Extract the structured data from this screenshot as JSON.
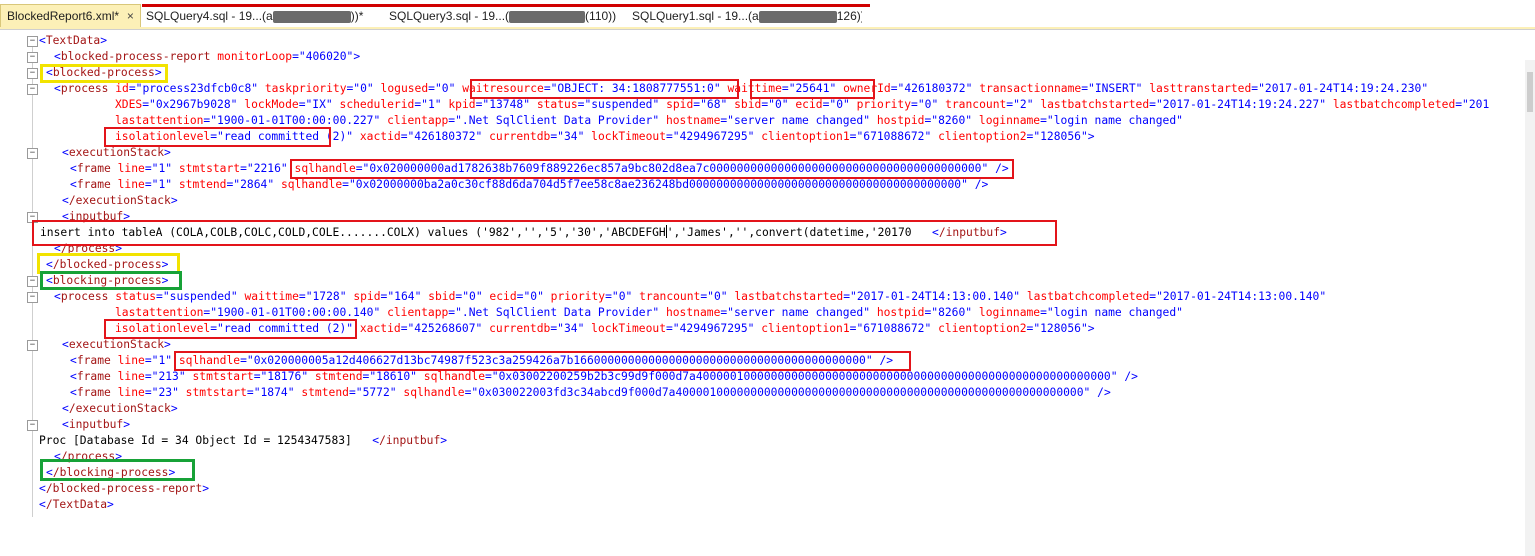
{
  "tabs": [
    {
      "label": "BlockedReport6.xml*",
      "active": true
    },
    {
      "label_a": "SQLQuery4.sql - 19...(a",
      "label_b": "))*"
    },
    {
      "label_a": "SQLQuery3.sql - 19...(",
      "label_b": "(110))"
    },
    {
      "label_a": "SQLQuery1.sql - 19...(a",
      "label_b": "126))"
    }
  ],
  "close_glyph": "×",
  "colors": {
    "highlight_red": "#e3141a",
    "highlight_yellow": "#f2e300",
    "highlight_green": "#17a237",
    "tag": "#a31515",
    "attr": "#ff0000",
    "bracket": "#0000ff"
  },
  "xml": {
    "l1": {
      "open": "<",
      "name": "TextData",
      "close": ">"
    },
    "l2": {
      "open": "<",
      "name": "blocked-process-report",
      "a1": " monitorLoop",
      "eq1": "=\"",
      "v1": "406020",
      "q1": "\"",
      "close": ">"
    },
    "l3": {
      "open": "<",
      "name": "blocked-process",
      "close": ">"
    },
    "l4": {
      "open": "<",
      "name": "process",
      "a1": " id",
      "v1": "process23dfcb0c8",
      "a2": " taskpriority",
      "v2": "0",
      "a3": " logused",
      "v3": "0",
      "a4": " waitresource",
      "v4": "OBJECT: 34:1808777551:0",
      "a5": " waittime",
      "v5": "25641",
      "a6": " ownerId",
      "v6": "426180372",
      "a7": " transactionname",
      "v7": "INSERT",
      "a8": " lasttranstarted",
      "v8": "2017-01-24T14:19:24.230"
    },
    "l5": {
      "a1": "XDES",
      "v1": "0x2967b9028",
      "a2": " lockMode",
      "v2": "IX",
      "a3": " schedulerid",
      "v3": "1",
      "a4": " kpid",
      "v4": "13748",
      "a5": " status",
      "v5": "suspended",
      "a6": " spid",
      "v6": "68",
      "a7": " sbid",
      "v7": "0",
      "a8": " ecid",
      "v8": "0",
      "a9": " priority",
      "v9": "0",
      "a10": " trancount",
      "v10": "2",
      "a11": " lastbatchstarted",
      "v11": "2017-01-24T14:19:24.227",
      "a12": " lastbatchcompleted",
      "v12": "201"
    },
    "l6": {
      "a1": "lastattention",
      "v1": "1900-01-01T00:00:00.227",
      "a2": " clientapp",
      "v2": ".Net SqlClient Data Provider",
      "a3": " hostname",
      "v3": "server name changed",
      "a4": " hostpid",
      "v4": "8260",
      "a5": " loginname",
      "v5": "login name changed"
    },
    "l7": {
      "a1": "isolationlevel",
      "v1": "read committed",
      "v1b": " (2)",
      "a2": " xactid",
      "v2": "426180372",
      "a3": " currentdb",
      "v3": "34",
      "a4": " lockTimeout",
      "v4": "4294967295",
      "a5": " clientoption1",
      "v5": "671088672",
      "a6": " clientoption2",
      "v6": "128056"
    },
    "l8": {
      "name": "executionStack"
    },
    "l9": {
      "name": "frame",
      "a1": " line",
      "v1": "1",
      "a2": " stmtstart",
      "v2": "2216",
      "a3": " sqlhandle",
      "v3": "0x020000000ad1782638b7609f889226ec857a9bc802d8ea7c0000000000000000000000000000000000000000"
    },
    "l10": {
      "name": "frame",
      "a1": " line",
      "v1": "1",
      "a2": " stmtend",
      "v2": "2864",
      "a3": " sqlhandle",
      "v3": "0x02000000ba2a0c30cf88d6da704d5f7ee58c8ae236248bd0000000000000000000000000000000000000000"
    },
    "l11": {
      "name": "/executionStack"
    },
    "l12": {
      "name": "inputbuf"
    },
    "l13": {
      "text_a": "insert into tableA (COLA,COLB,COLC,COLD,COLE.......COLX) values ('982','','5','30','ABCDEFGH",
      "text_b": "','James','',convert(datetime,'20170   ",
      "close_name": "/inputbuf"
    },
    "l14": {
      "name": "/process"
    },
    "l15": {
      "name": "/blocked-process"
    },
    "l16": {
      "name": "blocking-process"
    },
    "l17": {
      "name": "process",
      "a1": " status",
      "v1": "suspended",
      "a2": " waittime",
      "v2": "1728",
      "a3": " spid",
      "v3": "164",
      "a4": " sbid",
      "v4": "0",
      "a5": " ecid",
      "v5": "0",
      "a6": " priority",
      "v6": "0",
      "a7": " trancount",
      "v7": "0",
      "a8": " lastbatchstarted",
      "v8": "2017-01-24T14:13:00.140",
      "a9": " lastbatchcompleted",
      "v9": "2017-01-24T14:13:00.140"
    },
    "l18": {
      "a1": "lastattention",
      "v1": "1900-01-01T00:00:00.140",
      "a2": " clientapp",
      "v2": ".Net SqlClient Data Provider",
      "a3": " hostname",
      "v3": "server name changed",
      "a4": " hostpid",
      "v4": "8260",
      "a5": " loginname",
      "v5": "login name changed"
    },
    "l19": {
      "a1": "isolationlevel",
      "v1": "read committed (2)",
      "a2": " xactid",
      "v2": "425268607",
      "a3": " currentdb",
      "v3": "34",
      "a4": " lockTimeout",
      "v4": "4294967295",
      "a5": " clientoption1",
      "v5": "671088672",
      "a6": " clientoption2",
      "v6": "128056"
    },
    "l20": {
      "name": "executionStack"
    },
    "l21": {
      "name": "frame",
      "a1": " line",
      "v1": "1",
      "a2": " sqlhandle",
      "v2": "0x020000005a12d406627d13bc74987f523c3a259426a7b1660000000000000000000000000000000000000000"
    },
    "l22": {
      "name": "frame",
      "a1": " line",
      "v1": "213",
      "a2": " stmtstart",
      "v2": "18176",
      "a3": " stmtend",
      "v3": "18610",
      "a4": " sqlhandle",
      "v4": "0x03002200259b2b3c99d9f000d7a4000001000000000000000000000000000000000000000000000000000000"
    },
    "l23": {
      "name": "frame",
      "a1": " line",
      "v1": "23",
      "a2": " stmtstart",
      "v2": "1874",
      "a3": " stmtend",
      "v3": "5772",
      "a4": " sqlhandle",
      "v4": "0x030022003fd3c34abcd9f000d7a400001000000000000000000000000000000000000000000000000000000"
    },
    "l24": {
      "name": "/executionStack"
    },
    "l25": {
      "name": "inputbuf"
    },
    "l26": {
      "text": "Proc [Database Id = 34 Object Id = 1254347583]   ",
      "close_name": "/inputbuf"
    },
    "l27": {
      "name": "/process"
    },
    "l28": {
      "name": "/blocking-process"
    },
    "l29": {
      "name": "/blocked-process-report"
    },
    "l30": {
      "name": "/TextData"
    }
  },
  "glyphs": {
    "lt": "<",
    "gt": ">",
    "lts": "</",
    "slash_gt": " />",
    "eq": "=\"",
    "q": "\"",
    "qsp": "\" ",
    "minus": "−"
  }
}
